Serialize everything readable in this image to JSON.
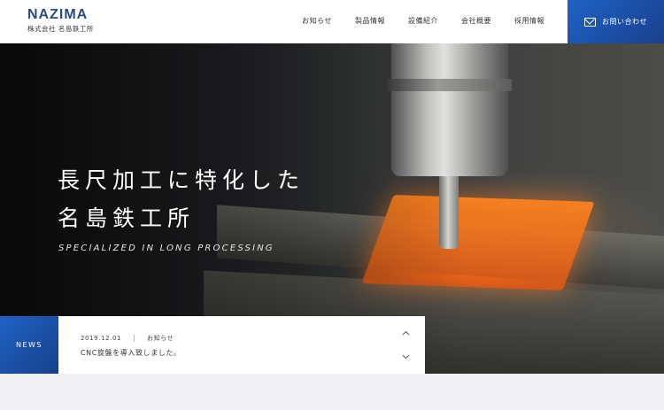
{
  "header": {
    "logo_mark": "NAZIMA",
    "logo_sub": "株式会社 名島鉄工所",
    "nav": [
      "お知らせ",
      "製品情報",
      "設備紹介",
      "会社概要",
      "採用情報"
    ],
    "contact_label": "お問い合わせ",
    "contact_icon": "mail-icon",
    "accent_color": "#1e5bb5"
  },
  "hero": {
    "title_line1": "長尺加工に特化した",
    "title_line2": "名島鉄工所",
    "subtitle": "SPECIALIZED IN LONG PROCESSING"
  },
  "news": {
    "tag": "NEWS",
    "date": "2019.12.01",
    "category": "お知らせ",
    "title": "CNC旋盤を導入致しました。",
    "prev_icon": "chevron-up-icon",
    "next_icon": "chevron-down-icon"
  }
}
